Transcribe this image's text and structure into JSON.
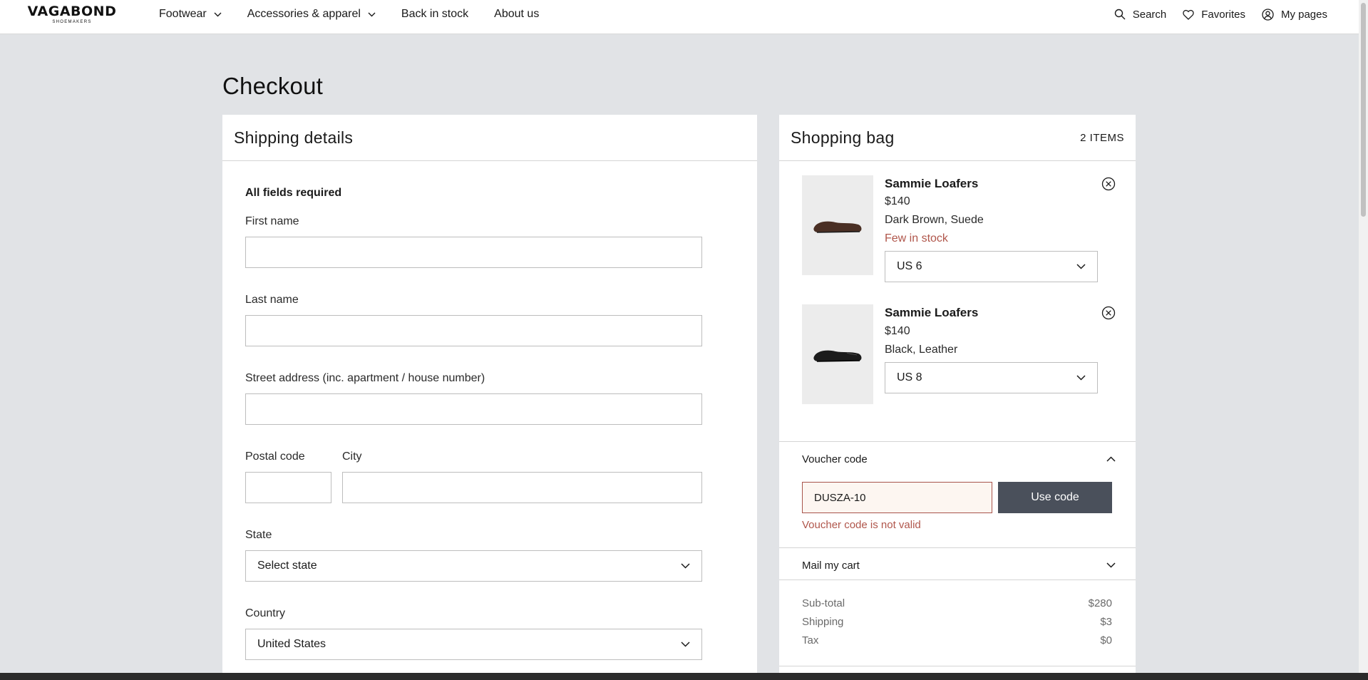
{
  "brand": {
    "logo_main": "VAGABOND",
    "logo_sub": "SHOEMAKERS"
  },
  "nav": {
    "items": [
      {
        "label": "Footwear",
        "has_dropdown": true
      },
      {
        "label": "Accessories & apparel",
        "has_dropdown": true
      },
      {
        "label": "Back in stock",
        "has_dropdown": false
      },
      {
        "label": "About us",
        "has_dropdown": false
      }
    ]
  },
  "utility": {
    "search": "Search",
    "favorites": "Favorites",
    "my_pages": "My pages"
  },
  "page": {
    "title": "Checkout"
  },
  "shipping": {
    "title": "Shipping details",
    "required_note": "All fields required",
    "first_name": {
      "label": "First name",
      "value": ""
    },
    "last_name": {
      "label": "Last name",
      "value": ""
    },
    "street": {
      "label": "Street address (inc. apartment / house number)",
      "value": ""
    },
    "postal": {
      "label": "Postal code",
      "value": ""
    },
    "city": {
      "label": "City",
      "value": ""
    },
    "state": {
      "label": "State",
      "selected": "Select state"
    },
    "country": {
      "label": "Country",
      "selected": "United States"
    }
  },
  "bag": {
    "title": "Shopping bag",
    "count": "2 ITEMS",
    "items": [
      {
        "name": "Sammie Loafers",
        "price": "$140",
        "variant": "Dark Brown, Suede",
        "stock": "Few in stock",
        "size": "US 6",
        "shoe_color": "#4a2f24"
      },
      {
        "name": "Sammie Loafers",
        "price": "$140",
        "variant": "Black, Leather",
        "stock": "",
        "size": "US 8",
        "shoe_color": "#1c1c1c"
      }
    ],
    "voucher": {
      "label": "Voucher code",
      "value": "DUSZA-10",
      "button": "Use code",
      "error": "Voucher code is not valid"
    },
    "mail_cart": "Mail my cart",
    "summary": {
      "subtotal_label": "Sub-total",
      "subtotal": "$280",
      "shipping_label": "Shipping",
      "shipping": "$3",
      "tax_label": "Tax",
      "tax": "$0"
    }
  },
  "colors": {
    "error": "#b0564b",
    "button": "#4a505b",
    "background": "#e1e3e6"
  }
}
